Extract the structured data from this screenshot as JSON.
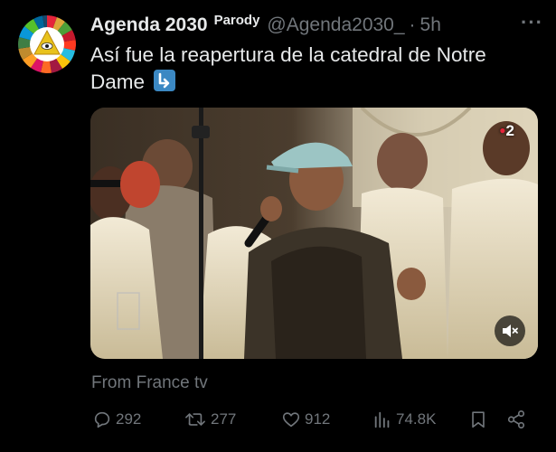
{
  "tweet": {
    "display_name": "Agenda 2030",
    "label": "Parody",
    "handle": "@Agenda2030_",
    "separator": "·",
    "time": "5h",
    "more_label": "···",
    "text": "Así fue la reapertura de la catedral de Notre Dame",
    "text_emoji": "down-right-arrow-emoji"
  },
  "media": {
    "channel_badge": "2",
    "mute_icon": "speaker-muted-icon"
  },
  "source": "From France tv",
  "actions": {
    "replies": "292",
    "reposts": "277",
    "likes": "912",
    "views": "74.8K"
  },
  "colors": {
    "text": "#e7e9ea",
    "secondary": "#71767b",
    "background": "#000000",
    "emoji_bg": "#3b88c3"
  }
}
